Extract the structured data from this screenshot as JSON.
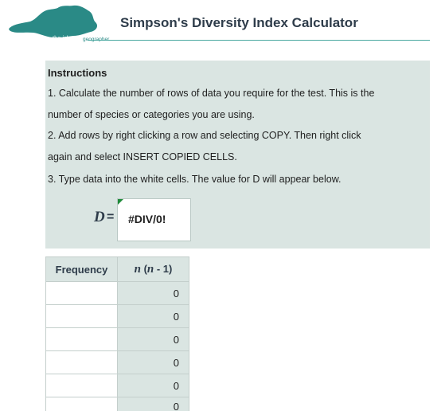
{
  "logo": {
    "text_part1": "the island",
    "text_part2": "geographer"
  },
  "header": {
    "title": "Simpson's Diversity Index Calculator"
  },
  "instructions": {
    "heading": "Instructions",
    "lines": [
      "1. Calculate the number of rows of data you require for the test. This is the",
      "number of species or categories you are using.",
      "2. Add rows by right clicking a row and selecting COPY. Then right click",
      "again and select INSERT COPIED CELLS.",
      "3. Type data into the white cells. The value for D will appear below."
    ]
  },
  "result": {
    "label": "D",
    "equals": "=",
    "value": "#DIV/0!"
  },
  "table": {
    "header_frequency": "Frequency",
    "header_nn_n1": "n",
    "header_nn_mid": " (",
    "header_nn_n2": "n",
    "header_nn_end": " - 1)",
    "rows": [
      {
        "frequency": "",
        "nn": "0"
      },
      {
        "frequency": "",
        "nn": "0"
      },
      {
        "frequency": "",
        "nn": "0"
      },
      {
        "frequency": "",
        "nn": "0"
      },
      {
        "frequency": "",
        "nn": "0"
      },
      {
        "frequency": "",
        "nn": "0"
      }
    ]
  },
  "colors": {
    "panel_bg": "#dae5e2",
    "accent_teal": "#2a8a86",
    "title_color": "#2e3c4a",
    "comment_flag": "#1e8a3a"
  }
}
